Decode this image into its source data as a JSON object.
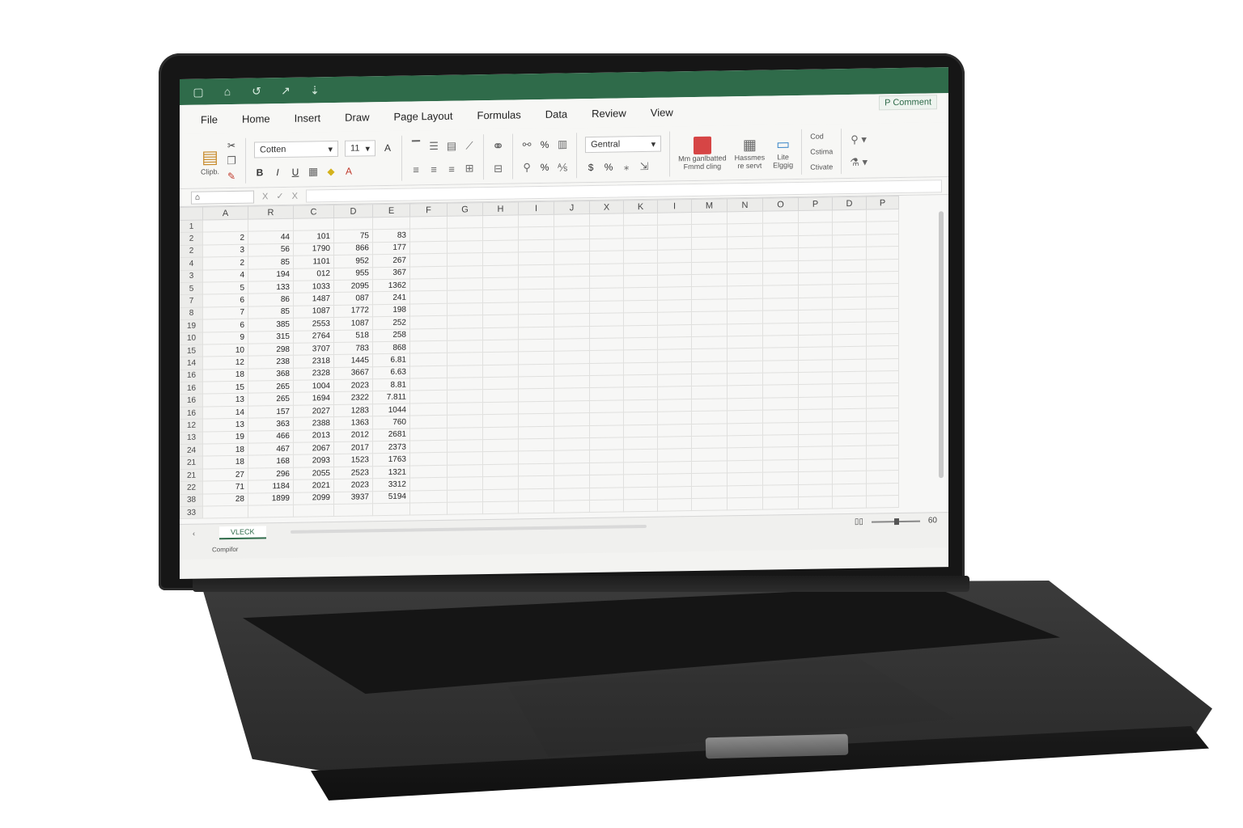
{
  "quick_access": [
    "▢",
    "⌂",
    "↺",
    "↗",
    "⇣"
  ],
  "menu": [
    "File",
    "Home",
    "Insert",
    "Draw",
    "Page Layout",
    "Formulas",
    "Data",
    "Review",
    "View"
  ],
  "comment_label": "P Comment",
  "ribbon": {
    "clipboard_label": "Clipb.",
    "font_name": "Cotten",
    "font_size": "11",
    "number_format": "Gentral",
    "bold": "B",
    "italic": "I",
    "underline": "U",
    "font_color": "A",
    "grow_font": "A",
    "currency": "$",
    "percent": "%",
    "styles_label_1": "Mm ganlbatted",
    "styles_label_2": "Fmmd cling",
    "styles_label_3": "Hassmes",
    "styles_label_4": "re servt",
    "styles_label_5": "Lite",
    "styles_label_6": "Elggig",
    "cells_label_1": "Cod",
    "cells_label_2": "Cstima",
    "cells_label_3": "Ctivate"
  },
  "formula_bar": {
    "name_box": "⌂",
    "cancel": "X",
    "confirm": "✓",
    "fx": "X"
  },
  "grid": {
    "columns": [
      "A",
      "R",
      "C",
      "D",
      "E",
      "F",
      "G",
      "H",
      "I",
      "J",
      "X",
      "K",
      "I",
      "M",
      "N",
      "O",
      "P",
      "D",
      "P"
    ],
    "row_labels": [
      "1",
      "2",
      "2",
      "4",
      "3",
      "5",
      "7",
      "8",
      "19",
      "10",
      "15",
      "14",
      "16",
      "16",
      "16",
      "16",
      "12",
      "13",
      "24",
      "21",
      "21",
      "22",
      "38",
      "33"
    ],
    "rows": [
      [
        "",
        "",
        "",
        "",
        ""
      ],
      [
        "2",
        "44",
        "101",
        "75",
        "83"
      ],
      [
        "3",
        "56",
        "1790",
        "866",
        "177"
      ],
      [
        "2",
        "85",
        "1101",
        "952",
        "267"
      ],
      [
        "4",
        "194",
        "012",
        "955",
        "367"
      ],
      [
        "5",
        "133",
        "1033",
        "2095",
        "1362"
      ],
      [
        "6",
        "86",
        "1487",
        "087",
        "241"
      ],
      [
        "7",
        "85",
        "1087",
        "1772",
        "198"
      ],
      [
        "6",
        "385",
        "2553",
        "1087",
        "252"
      ],
      [
        "9",
        "315",
        "2764",
        "518",
        "258"
      ],
      [
        "10",
        "298",
        "3707",
        "783",
        "868"
      ],
      [
        "12",
        "238",
        "2318",
        "1445",
        "6.81"
      ],
      [
        "18",
        "368",
        "2328",
        "3667",
        "6.63"
      ],
      [
        "15",
        "265",
        "1004",
        "2023",
        "8.81"
      ],
      [
        "13",
        "265",
        "1694",
        "2322",
        "7.811"
      ],
      [
        "14",
        "157",
        "2027",
        "1283",
        "1044"
      ],
      [
        "13",
        "363",
        "2388",
        "1363",
        "760"
      ],
      [
        "19",
        "466",
        "2013",
        "2012",
        "2681"
      ],
      [
        "18",
        "467",
        "2067",
        "2017",
        "2373"
      ],
      [
        "18",
        "168",
        "2093",
        "1523",
        "1763"
      ],
      [
        "27",
        "296",
        "2055",
        "2523",
        "1321"
      ],
      [
        "71",
        "1184",
        "2021",
        "2023",
        "3312"
      ],
      [
        "28",
        "1899",
        "2099",
        "3937",
        "5194"
      ],
      [
        "",
        "",
        "",
        "",
        ""
      ]
    ]
  },
  "sheet_tab": "VLECK",
  "sheet_prefix": "‹",
  "zoom_text": "60",
  "status_text": "Compifor"
}
